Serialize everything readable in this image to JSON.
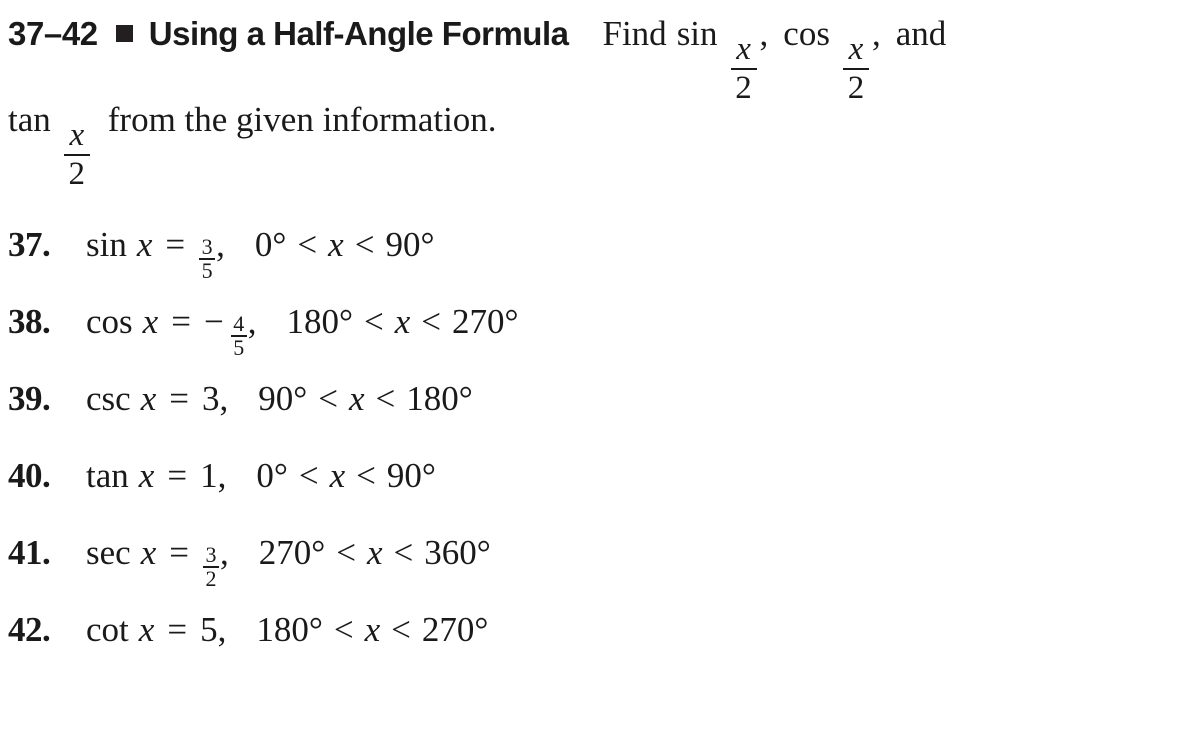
{
  "directions": {
    "exercise_range": "37–42",
    "bullet": "square-bullet",
    "title": "Using a Half-Angle Formula",
    "line1_lead": "Find",
    "line1_func1": "sin",
    "line1_frac1_num": "x",
    "line1_frac1_den": "2",
    "line1_sep1": ",",
    "line1_func2": "cos",
    "line1_frac2_num": "x",
    "line1_frac2_den": "2",
    "line1_sep2": ",",
    "line1_tail": "and",
    "line2_func": "tan",
    "line2_frac_num": "x",
    "line2_frac_den": "2",
    "line2_tail": "from the given information."
  },
  "exercises": [
    {
      "number": "37.",
      "function": "sin",
      "variable": "x",
      "equals": "=",
      "value_type": "fraction",
      "negative": "",
      "numerator": "3",
      "denominator": "5",
      "value": "",
      "comma": ",",
      "lower_bound": "0°",
      "rel1": "<",
      "range_var": "x",
      "rel2": "<",
      "upper_bound": "90°"
    },
    {
      "number": "38.",
      "function": "cos",
      "variable": "x",
      "equals": "=",
      "value_type": "fraction",
      "negative": "−",
      "numerator": "4",
      "denominator": "5",
      "value": "",
      "comma": ",",
      "lower_bound": "180°",
      "rel1": "<",
      "range_var": "x",
      "rel2": "<",
      "upper_bound": "270°"
    },
    {
      "number": "39.",
      "function": "csc",
      "variable": "x",
      "equals": "=",
      "value_type": "scalar",
      "negative": "",
      "numerator": "",
      "denominator": "",
      "value": "3",
      "comma": ",",
      "lower_bound": "90°",
      "rel1": "<",
      "range_var": "x",
      "rel2": "<",
      "upper_bound": "180°"
    },
    {
      "number": "40.",
      "function": "tan",
      "variable": "x",
      "equals": "=",
      "value_type": "scalar",
      "negative": "",
      "numerator": "",
      "denominator": "",
      "value": "1",
      "comma": ",",
      "lower_bound": "0°",
      "rel1": "<",
      "range_var": "x",
      "rel2": "<",
      "upper_bound": "90°"
    },
    {
      "number": "41.",
      "function": "sec",
      "variable": "x",
      "equals": "=",
      "value_type": "fraction",
      "negative": "",
      "numerator": "3",
      "denominator": "2",
      "value": "",
      "comma": ",",
      "lower_bound": "270°",
      "rel1": "<",
      "range_var": "x",
      "rel2": "<",
      "upper_bound": "360°"
    },
    {
      "number": "42.",
      "function": "cot",
      "variable": "x",
      "equals": "=",
      "value_type": "scalar",
      "negative": "",
      "numerator": "",
      "denominator": "",
      "value": "5",
      "comma": ",",
      "lower_bound": "180°",
      "rel1": "<",
      "range_var": "x",
      "rel2": "<",
      "upper_bound": "270°"
    }
  ],
  "colors": {
    "text": "#1a1a1a",
    "bullet": "#231f20",
    "background": "#ffffff"
  }
}
